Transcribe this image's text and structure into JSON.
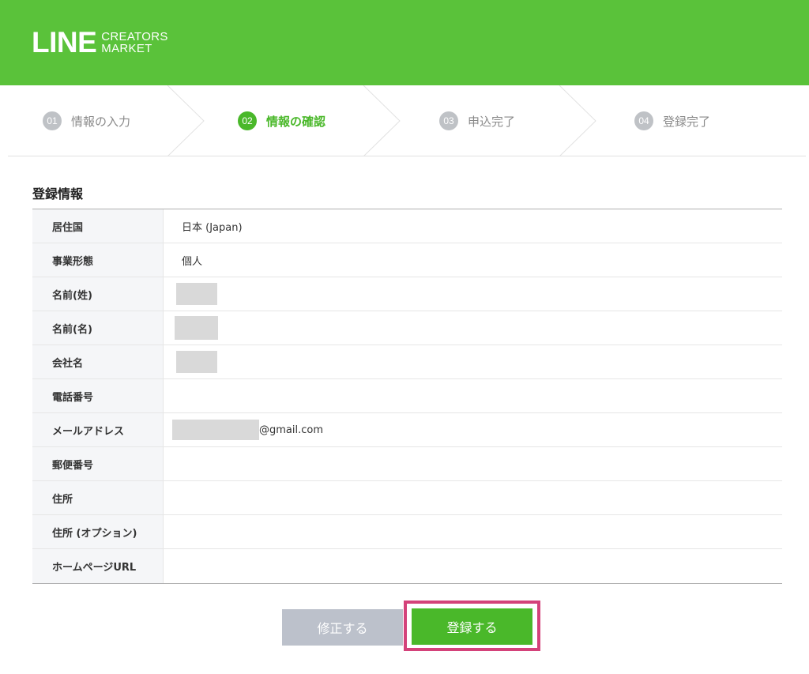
{
  "header": {
    "logo_main": "LINE",
    "logo_sub1": "CREATORS",
    "logo_sub2": "MARKET",
    "brand_color": "#5ac23a"
  },
  "steps": [
    {
      "num": "01",
      "label": "情報の入力",
      "active": false
    },
    {
      "num": "02",
      "label": "情報の確認",
      "active": true
    },
    {
      "num": "03",
      "label": "申込完了",
      "active": false
    },
    {
      "num": "04",
      "label": "登録完了",
      "active": false
    }
  ],
  "section": {
    "title": "登録情報"
  },
  "rows": [
    {
      "label": "居住国",
      "value": "日本 (Japan)"
    },
    {
      "label": "事業形態",
      "value": "個人"
    },
    {
      "label": "名前(姓)",
      "value": "",
      "redacted": true
    },
    {
      "label": "名前(名)",
      "value": "",
      "redacted": true
    },
    {
      "label": "会社名",
      "value": "",
      "redacted": true
    },
    {
      "label": "電話番号",
      "value": ""
    },
    {
      "label": "メールアドレス",
      "value": "@gmail.com",
      "redacted": true
    },
    {
      "label": "郵便番号",
      "value": ""
    },
    {
      "label": "住所",
      "value": ""
    },
    {
      "label": "住所 (オプション)",
      "value": ""
    },
    {
      "label": "ホームページURL",
      "value": ""
    }
  ],
  "buttons": {
    "edit": "修正する",
    "register": "登録する"
  },
  "colors": {
    "accent": "#4ab82a",
    "highlight": "#d4427a",
    "edit_button": "#bcc1cb"
  }
}
